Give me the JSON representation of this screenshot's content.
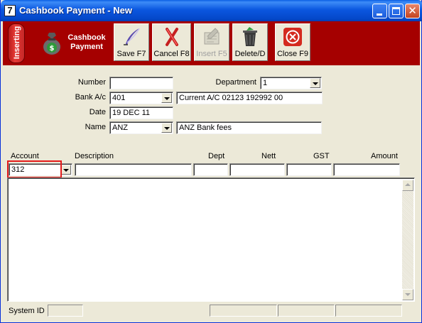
{
  "window": {
    "app_icon": "7",
    "title": "Cashbook Payment - New",
    "controls": {
      "minimize_icon": "minimize-icon",
      "maximize_icon": "maximize-icon",
      "close_icon": "close-icon",
      "close_glyph": "✕"
    }
  },
  "toolbar": {
    "mode_label": "Inserting",
    "module_label": "Cashbook Payment",
    "module_icon": "money-bag-icon",
    "buttons": {
      "save": {
        "label": "Save F7",
        "icon": "quill-icon",
        "enabled": true
      },
      "cancel": {
        "label": "Cancel F8",
        "icon": "red-x-icon",
        "enabled": true
      },
      "insert": {
        "label": "Insert F5",
        "icon": "insert-icon",
        "enabled": false
      },
      "delete": {
        "label": "Delete/D",
        "icon": "trash-icon",
        "enabled": true
      },
      "close": {
        "label": "Close F9",
        "icon": "close-circle-icon",
        "enabled": true
      }
    },
    "colors": {
      "toolbar_bg": "#a50000"
    }
  },
  "form": {
    "number": {
      "label": "Number",
      "value": ""
    },
    "department": {
      "label": "Department",
      "value": "1"
    },
    "bank_ac": {
      "label": "Bank A/c",
      "value": "401",
      "description": "Current A/C 02123 192992 00"
    },
    "date": {
      "label": "Date",
      "value": "19 DEC 11"
    },
    "name": {
      "label": "Name",
      "value": "ANZ",
      "description": "ANZ Bank fees"
    }
  },
  "lines": {
    "columns": {
      "account": "Account",
      "description": "Description",
      "dept": "Dept",
      "nett": "Nett",
      "gst": "GST",
      "amount": "Amount"
    },
    "entry": {
      "account": "312",
      "description": "",
      "dept": "",
      "nett": "",
      "gst": "",
      "amount": ""
    },
    "rows": []
  },
  "status": {
    "system_id_label": "System ID",
    "system_id_value": "",
    "panels": [
      "",
      "",
      ""
    ]
  }
}
